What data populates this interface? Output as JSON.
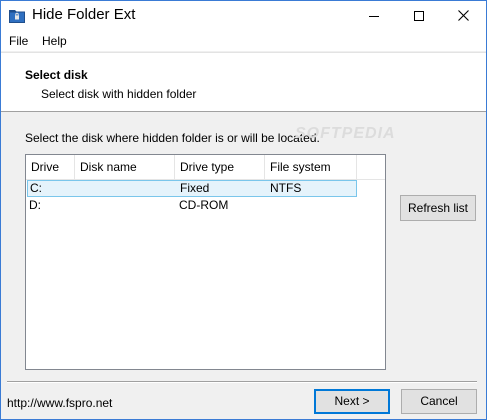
{
  "window": {
    "title": "Hide Folder Ext",
    "icon": "folder-lock-icon",
    "controls": {
      "minimize_icon": "minimize-icon",
      "maximize_icon": "maximize-icon",
      "close_icon": "close-icon"
    }
  },
  "menu": {
    "file": "File",
    "help": "Help"
  },
  "header": {
    "title": "Select disk",
    "subtitle": "Select disk with hidden folder"
  },
  "main": {
    "instruction": "Select the disk where hidden folder is or will be located.",
    "watermark": "SOFTPEDIA",
    "list": {
      "columns": [
        "Drive",
        "Disk name",
        "Drive type",
        "File system"
      ],
      "rows": [
        {
          "drive": "C:",
          "disk_name": "",
          "drive_type": "Fixed",
          "file_system": "NTFS",
          "selected": true
        },
        {
          "drive": "D:",
          "disk_name": "",
          "drive_type": "CD-ROM",
          "file_system": "",
          "selected": false
        }
      ]
    },
    "refresh_label": "Refresh list"
  },
  "footer": {
    "url": "http://www.fspro.net",
    "next_label": "Next >",
    "cancel_label": "Cancel"
  },
  "colors": {
    "window_border": "#3a7bd5",
    "selection_bg": "#e5f3fb",
    "selection_border": "#7ac6eb",
    "default_button_border": "#0078d7"
  }
}
